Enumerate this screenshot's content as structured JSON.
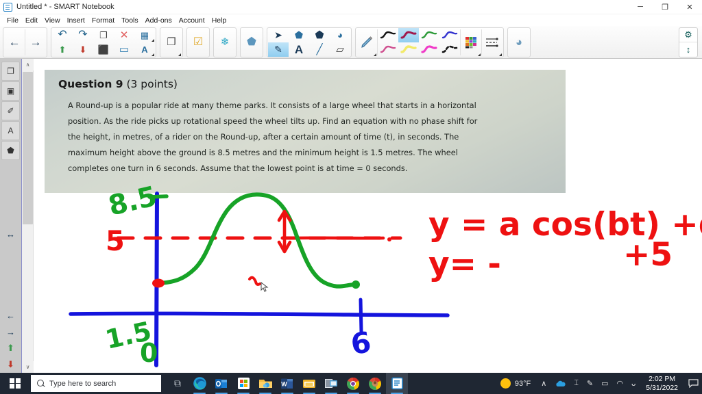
{
  "window": {
    "title": "Untitled * - SMART Notebook",
    "app_icon": "notebook-icon",
    "minimize": "─",
    "maximize": "❐",
    "close": "✕"
  },
  "menubar": {
    "items": [
      {
        "label": "File"
      },
      {
        "label": "Edit"
      },
      {
        "label": "View"
      },
      {
        "label": "Insert"
      },
      {
        "label": "Format"
      },
      {
        "label": "Tools"
      },
      {
        "label": "Add-ons"
      },
      {
        "label": "Account"
      },
      {
        "label": "Help"
      }
    ]
  },
  "toolbar": {
    "previous_page": "←",
    "next_page": "→",
    "undo": "↶",
    "redo": "↷",
    "new_page": "❐",
    "delete": "✕",
    "table": "▦",
    "import_page": "⬆",
    "export_page": "⬇",
    "save": "⬛",
    "screen_shade": "▭",
    "measurement_tools": "A",
    "full_screen": "❐",
    "screen_capture": "☑",
    "smart_exchange": "❄",
    "shapes_extra": "⬟",
    "select": "➤",
    "shape_select": "⬟",
    "shapes": "⬟",
    "fill": "◕",
    "pens": "✎",
    "text": "A",
    "lines": "╱",
    "eraser": "▱",
    "pen_tool": "✎",
    "line_color": "▬",
    "properties": "☰",
    "paint_can": "◕",
    "settings_gear": "⚙",
    "move_toolbar": "↕",
    "pen_styles_row1": [
      "#151515",
      "#b2125a",
      "#2e9b3a",
      "#3434cf"
    ],
    "pen_styles_row2": [
      "#cf4f8f",
      "#f2ea6a",
      "#f03cc8",
      "#151515"
    ],
    "selected_pen_index": 1
  },
  "sidebar": {
    "items": [
      {
        "name": "page-sorter",
        "glyph": "❐"
      },
      {
        "name": "gallery",
        "glyph": "▣"
      },
      {
        "name": "attachments",
        "glyph": "✐"
      },
      {
        "name": "add-ons",
        "glyph": "A"
      },
      {
        "name": "smart-response",
        "glyph": "⬟"
      }
    ],
    "auto_hide": "↔",
    "nav_back": "←",
    "nav_forward": "→",
    "import": "⬆",
    "export": "⬇"
  },
  "canvas": {
    "scroll_up": "∧",
    "scroll_down": "∨"
  },
  "question": {
    "title_bold": "Question 9",
    "title_rest": " (3 points)",
    "lines": [
      "A Round-up is a popular ride at many theme parks.  It consists of a large wheel that starts in a horizontal",
      "position.  As the ride picks up rotational speed the wheel tilts up. Find an equation with no phase shift for",
      "the height, in metres, of a rider on the Round-up, after a certain amount of time (t), in seconds.  The",
      "maximum height above the ground is 8.5 metres and the minimum height is 1.5 metres.  The wheel",
      "completes one turn in 6 seconds.   Assume that the lowest point is at time = 0 seconds."
    ]
  },
  "ink": {
    "label_max": "8.5",
    "label_mid": "5",
    "label_min": "1.5",
    "label_origin": "0",
    "label_period": "6",
    "equation_line1": "y = a cos(bt) +d",
    "equation_line2": "y= -",
    "equation_line3": "+5",
    "colors": {
      "green": "#17a327",
      "red": "#ee1111",
      "blue": "#1414dd"
    }
  },
  "taskbar": {
    "start": "start-button",
    "search_placeholder": "Type here to search",
    "task_view": "⧉",
    "apps": [
      {
        "name": "microsoft-edge",
        "glyph": "e"
      },
      {
        "name": "outlook",
        "glyph": "O"
      },
      {
        "name": "microsoft-store",
        "glyph": "⊞"
      },
      {
        "name": "file-explorer",
        "glyph": "▱"
      },
      {
        "name": "microsoft-word",
        "glyph": "W"
      },
      {
        "name": "photos",
        "glyph": "▣"
      },
      {
        "name": "remote-desktop",
        "glyph": "⌸"
      },
      {
        "name": "google-chrome-window-1",
        "glyph": "◉"
      },
      {
        "name": "google-chrome-window-2",
        "glyph": "◉"
      },
      {
        "name": "smart-notebook",
        "glyph": "✎"
      }
    ],
    "tray": {
      "show_hidden": "∧",
      "onedrive": "☁",
      "temperature_probe": "⌶",
      "smart_ink": "✎",
      "battery": "▭",
      "network": "◠",
      "volume": "ᴗ",
      "weather_temp": "93°F",
      "weather_icon": "sun-icon",
      "time": "2:02 PM",
      "date": "5/31/2022",
      "action_center": "⬜"
    }
  }
}
